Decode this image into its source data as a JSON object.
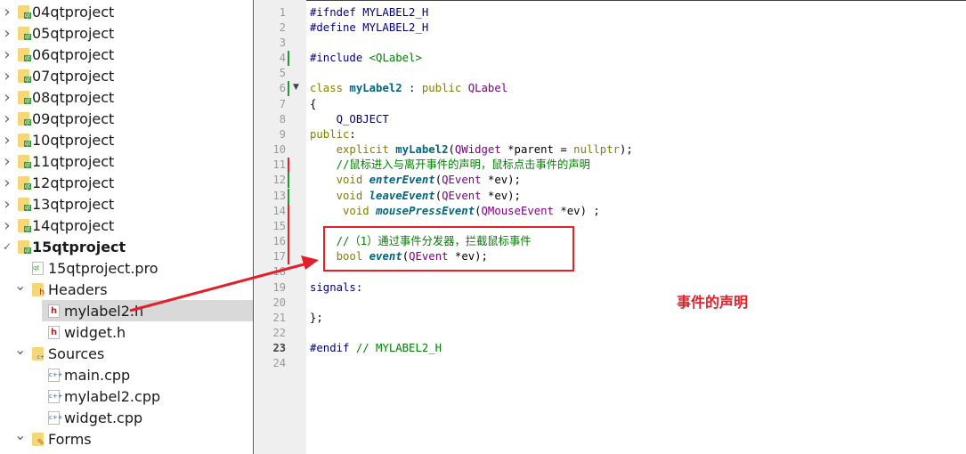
{
  "tree": [
    {
      "label": "04qtproject",
      "level": 0,
      "kind": "project",
      "expander": "collapsed"
    },
    {
      "label": "05qtproject",
      "level": 0,
      "kind": "project",
      "expander": "collapsed"
    },
    {
      "label": "06qtproject",
      "level": 0,
      "kind": "project",
      "expander": "collapsed"
    },
    {
      "label": "07qtproject",
      "level": 0,
      "kind": "project",
      "expander": "collapsed"
    },
    {
      "label": "08qtproject",
      "level": 0,
      "kind": "project",
      "expander": "collapsed"
    },
    {
      "label": "09qtproject",
      "level": 0,
      "kind": "project",
      "expander": "collapsed"
    },
    {
      "label": "10qtproject",
      "level": 0,
      "kind": "project",
      "expander": "collapsed"
    },
    {
      "label": "11qtproject",
      "level": 0,
      "kind": "project",
      "expander": "collapsed"
    },
    {
      "label": "12qtproject",
      "level": 0,
      "kind": "project",
      "expander": "collapsed"
    },
    {
      "label": "13qtproject",
      "level": 0,
      "kind": "project",
      "expander": "collapsed"
    },
    {
      "label": "14qtproject",
      "level": 0,
      "kind": "project",
      "expander": "collapsed"
    },
    {
      "label": "15qtproject",
      "level": 0,
      "kind": "project",
      "expander": "expanded",
      "bold": true
    },
    {
      "label": "15qtproject.pro",
      "level": 1,
      "kind": "pro-file",
      "expander": "none"
    },
    {
      "label": "Headers",
      "level": 1,
      "kind": "headers-folder",
      "expander": "expanded"
    },
    {
      "label": "mylabel2.h",
      "level": 2,
      "kind": "header-file",
      "expander": "none",
      "selected": true
    },
    {
      "label": "widget.h",
      "level": 2,
      "kind": "header-file",
      "expander": "none"
    },
    {
      "label": "Sources",
      "level": 1,
      "kind": "sources-folder",
      "expander": "expanded"
    },
    {
      "label": "main.cpp",
      "level": 2,
      "kind": "cpp-file",
      "expander": "none"
    },
    {
      "label": "mylabel2.cpp",
      "level": 2,
      "kind": "cpp-file",
      "expander": "none"
    },
    {
      "label": "widget.cpp",
      "level": 2,
      "kind": "cpp-file",
      "expander": "none"
    },
    {
      "label": "Forms",
      "level": 1,
      "kind": "forms-folder",
      "expander": "expanded"
    }
  ],
  "editor": {
    "current_line": 23,
    "folded_line": 6,
    "markers": {
      "4": "green",
      "6": "green",
      "11": "red",
      "12": "green",
      "13": "green",
      "14": "red",
      "15": "red",
      "16": "red",
      "17": "red"
    },
    "lines": [
      [
        [
          "#ifndef MYLABEL2_H",
          "pp"
        ]
      ],
      [
        [
          "#define MYLABEL2_H",
          "pp"
        ]
      ],
      [],
      [
        [
          "#include ",
          "pp"
        ],
        [
          "<QLabel>",
          "cm"
        ]
      ],
      [],
      [
        [
          "class ",
          "kw"
        ],
        [
          "myLabel2",
          "fn"
        ],
        [
          " : ",
          ""
        ],
        [
          "public ",
          "kw"
        ],
        [
          "QLabel",
          "ty"
        ]
      ],
      [
        [
          "{",
          ""
        ]
      ],
      [
        [
          "    Q_OBJECT",
          "pp"
        ]
      ],
      [
        [
          "public",
          "kw"
        ],
        [
          ":",
          ""
        ]
      ],
      [
        [
          "    ",
          ""
        ],
        [
          "explicit ",
          "kw"
        ],
        [
          "myLabel2",
          "fn"
        ],
        [
          "(",
          ""
        ],
        [
          "QWidget",
          "ty"
        ],
        [
          " *parent = ",
          ""
        ],
        [
          "nullptr",
          "kw"
        ],
        [
          ");",
          ""
        ]
      ],
      [
        [
          "    //鼠标进入与离开事件的声明，鼠标点击事件的声明",
          "cm"
        ]
      ],
      [
        [
          "    ",
          ""
        ],
        [
          "void ",
          "kw"
        ],
        [
          "enterEvent",
          "fni"
        ],
        [
          "(",
          ""
        ],
        [
          "QEvent",
          "ty"
        ],
        [
          " *ev);",
          ""
        ]
      ],
      [
        [
          "    ",
          ""
        ],
        [
          "void ",
          "kw"
        ],
        [
          "leaveEvent",
          "fni"
        ],
        [
          "(",
          ""
        ],
        [
          "QEvent",
          "ty"
        ],
        [
          " *ev);",
          ""
        ]
      ],
      [
        [
          "     ",
          ""
        ],
        [
          "void ",
          "kw"
        ],
        [
          "mousePressEvent",
          "fni"
        ],
        [
          "(",
          ""
        ],
        [
          "QMouseEvent",
          "ty"
        ],
        [
          " *ev) ;",
          ""
        ]
      ],
      [],
      [
        [
          "    //（1）通过事件分发器，拦截鼠标事件",
          "cm"
        ]
      ],
      [
        [
          "    ",
          ""
        ],
        [
          "bool ",
          "kw"
        ],
        [
          "event",
          "fni"
        ],
        [
          "(",
          ""
        ],
        [
          "QEvent",
          "ty"
        ],
        [
          " *ev);",
          ""
        ]
      ],
      [],
      [
        [
          "signals",
          "pp"
        ],
        [
          ":",
          ""
        ]
      ],
      [],
      [
        [
          "};",
          ""
        ]
      ],
      [],
      [
        [
          "#endif ",
          "pp"
        ],
        [
          "// MYLABEL2_H",
          "cm"
        ]
      ],
      []
    ]
  },
  "annotation": {
    "text": "事件的声明",
    "color": "#e3202a"
  },
  "colors": {
    "marker_green": "#1e9a2e",
    "marker_red": "#e3202a",
    "selection": "#d9d9d9"
  }
}
